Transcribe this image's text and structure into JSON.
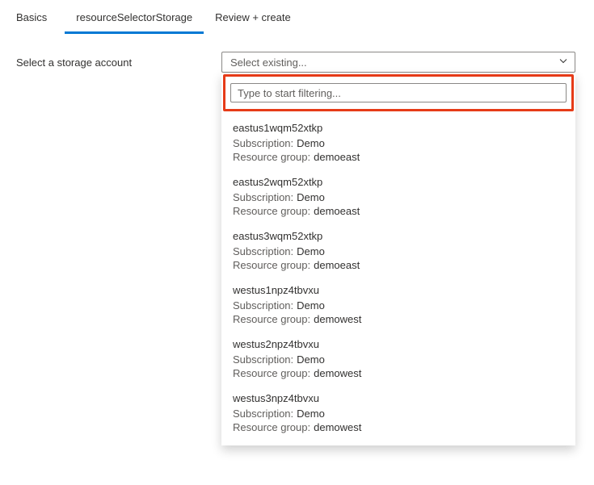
{
  "tabs": [
    {
      "label": "Basics",
      "active": false
    },
    {
      "label": "resourceSelectorStorage",
      "active": true
    },
    {
      "label": "Review + create",
      "active": false
    }
  ],
  "form": {
    "label": "Select a storage account",
    "select_placeholder": "Select existing...",
    "filter_placeholder": "Type to start filtering..."
  },
  "meta_labels": {
    "subscription": "Subscription:",
    "resource_group": "Resource group:"
  },
  "options": [
    {
      "name": "eastus1wqm52xtkp",
      "subscription": "Demo",
      "resource_group": "demoeast"
    },
    {
      "name": "eastus2wqm52xtkp",
      "subscription": "Demo",
      "resource_group": "demoeast"
    },
    {
      "name": "eastus3wqm52xtkp",
      "subscription": "Demo",
      "resource_group": "demoeast"
    },
    {
      "name": "westus1npz4tbvxu",
      "subscription": "Demo",
      "resource_group": "demowest"
    },
    {
      "name": "westus2npz4tbvxu",
      "subscription": "Demo",
      "resource_group": "demowest"
    },
    {
      "name": "westus3npz4tbvxu",
      "subscription": "Demo",
      "resource_group": "demowest"
    }
  ]
}
